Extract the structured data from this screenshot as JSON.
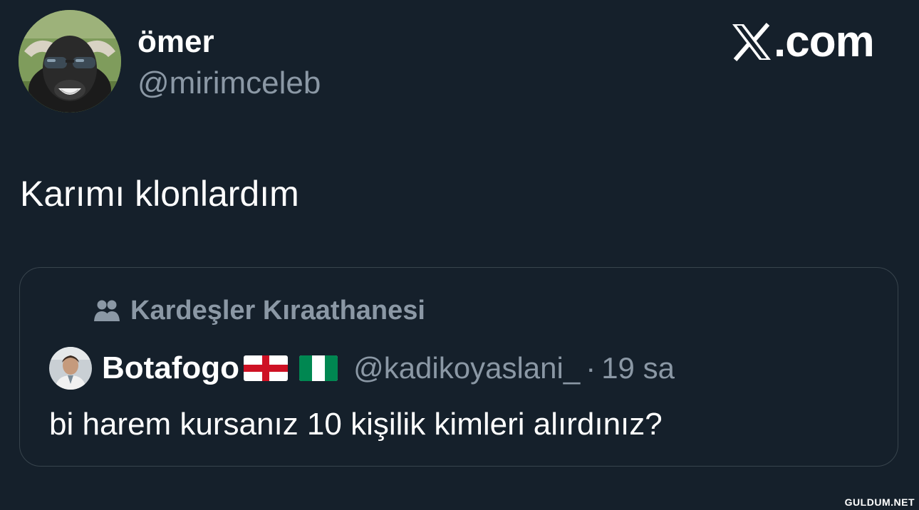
{
  "post": {
    "author": {
      "display_name": "ömer",
      "handle": "@mirimceleb",
      "avatar_icon": "cool-buffalo-avatar"
    },
    "text": "Karımı klonlardım"
  },
  "brand": {
    "site_name": ".com",
    "logo_icon": "x-logo-icon"
  },
  "quoted_post": {
    "community": {
      "icon": "community-people-icon",
      "name": "Kardeşler Kıraathanesi"
    },
    "author": {
      "display_name": "Botafogo",
      "handle": "@kadikoyaslani_",
      "avatar_icon": "user-avatar",
      "flags": [
        "england-flag-icon",
        "nigeria-flag-icon"
      ]
    },
    "separator": "·",
    "time": "19 sa",
    "text": "bi harem kursanız 10 kişilik kimleri alırdınız?"
  },
  "watermark": "GULDUM.NET",
  "colors": {
    "background": "#15202b",
    "text_primary": "#ffffff",
    "text_secondary": "#8b98a5",
    "card_border": "#38444d"
  }
}
